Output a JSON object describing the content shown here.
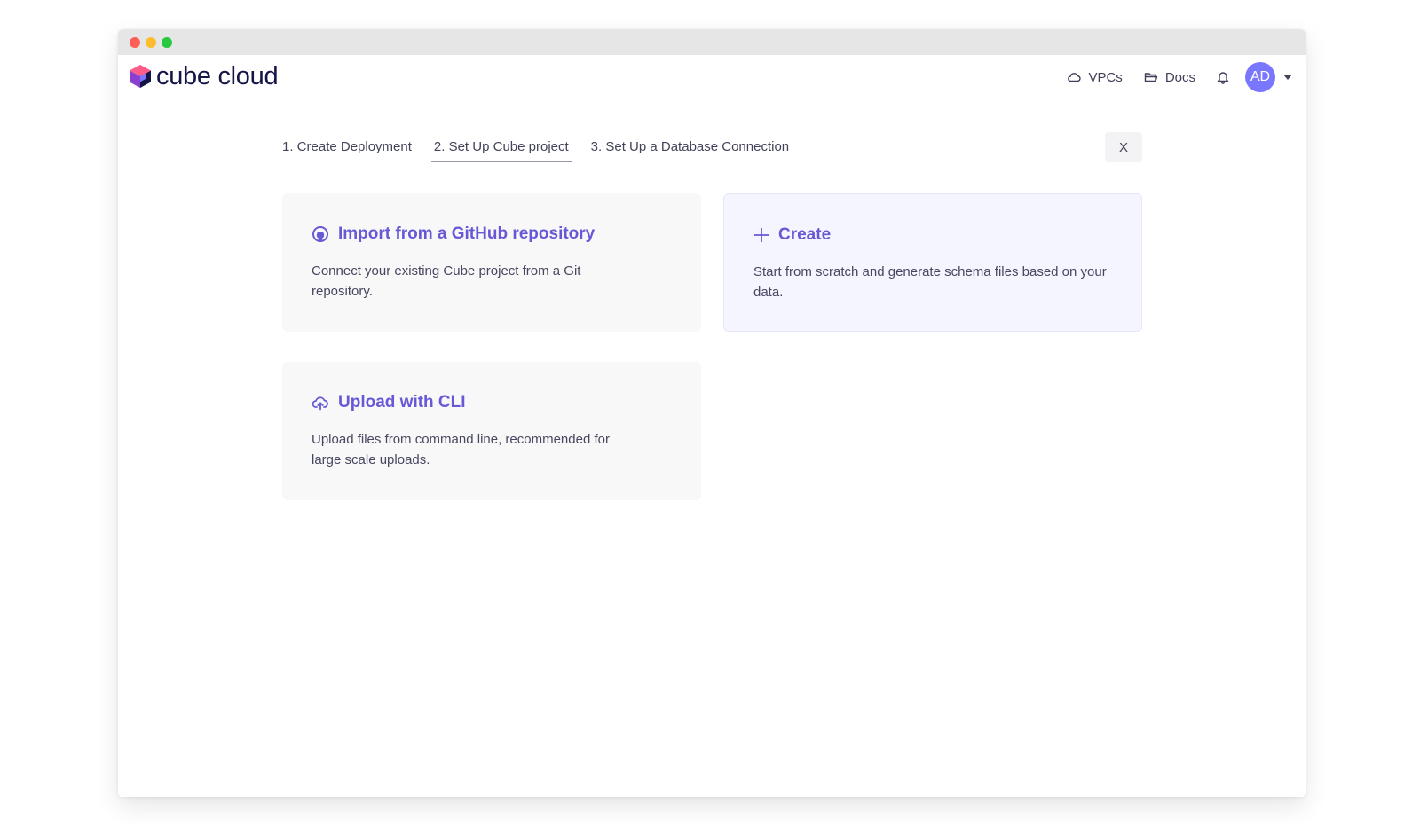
{
  "brand": {
    "name": "cube cloud",
    "logo_icon": "cube-logo-icon",
    "accent_color": "#6759d6"
  },
  "nav": {
    "vpcs_label": "VPCs",
    "vpcs_icon": "cloud-icon",
    "docs_label": "Docs",
    "docs_icon": "folder-icon",
    "notifications_icon": "bell-icon",
    "avatar_initials": "AD",
    "avatar_color": "#7a77ff",
    "menu_icon": "caret-down-icon"
  },
  "steps": [
    {
      "label": "1. Create Deployment",
      "active": false
    },
    {
      "label": "2. Set Up Cube project",
      "active": true
    },
    {
      "label": "3. Set Up a Database Connection",
      "active": false
    }
  ],
  "close_label": "X",
  "options": [
    {
      "icon": "github-icon",
      "title": "Import from a GitHub repository",
      "description": "Connect your existing Cube project from a Git repository."
    },
    {
      "icon": "plus-icon",
      "title": "Create",
      "description": "Start from scratch and generate schema files based on your data.",
      "highlighted": true
    },
    {
      "icon": "cloud-upload-icon",
      "title": "Upload with CLI",
      "description": "Upload files from command line, recommended for large scale uploads."
    }
  ]
}
